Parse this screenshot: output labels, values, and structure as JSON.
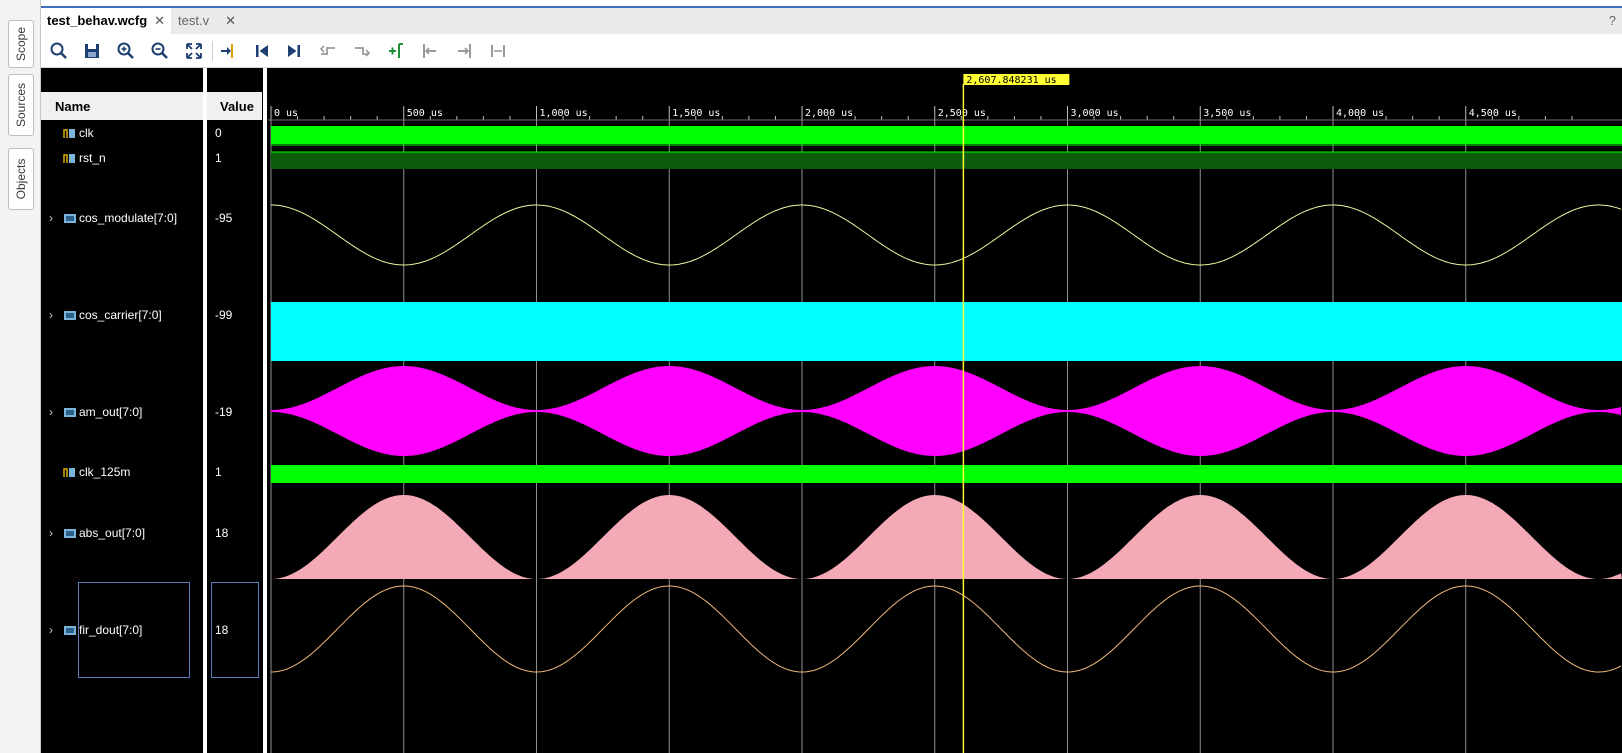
{
  "side_tabs": [
    "Scope",
    "Sources",
    "Objects"
  ],
  "tabs": [
    {
      "label": "test_behav.wcfg",
      "active": true
    },
    {
      "label": "test.v",
      "active": false
    }
  ],
  "help": "?",
  "toolbar_icons": [
    "zoom-search-icon",
    "save-icon",
    "zoom-in-icon",
    "zoom-out-icon",
    "zoom-fit-icon",
    "goto-cursor-icon",
    "go-to-start-icon",
    "go-to-end-icon",
    "previous-transition-icon",
    "next-transition-icon",
    "add-marker-icon",
    "previous-marker-icon",
    "next-marker-icon",
    "swap-cursors-icon"
  ],
  "columns": {
    "name": "Name",
    "value": "Value"
  },
  "cursor": {
    "time_label": "2,607.848231 us",
    "time_us": 2607.848231
  },
  "timeline": {
    "unit": "us",
    "ticks": [
      "0 us",
      "500 us",
      "1,000 us",
      "1,500 us",
      "2,000 us",
      "2,500 us",
      "3,000 us",
      "3,500 us",
      "4,000 us",
      "4,500 us"
    ]
  },
  "signals": [
    {
      "name": "clk",
      "value": "0",
      "kind": "bit",
      "expandable": false
    },
    {
      "name": "rst_n",
      "value": "1",
      "kind": "bit",
      "expandable": false
    },
    {
      "name": "cos_modulate[7:0]",
      "value": "-95",
      "kind": "bus",
      "expandable": true
    },
    {
      "name": "cos_carrier[7:0]",
      "value": "-99",
      "kind": "bus",
      "expandable": true
    },
    {
      "name": "am_out[7:0]",
      "value": "-19",
      "kind": "bus",
      "expandable": true
    },
    {
      "name": "clk_125m",
      "value": "1",
      "kind": "bit",
      "expandable": false
    },
    {
      "name": "abs_out[7:0]",
      "value": "18",
      "kind": "bus",
      "expandable": true
    },
    {
      "name": "fir_dout[7:0]",
      "value": "18",
      "kind": "bus",
      "expandable": true
    }
  ],
  "colors": {
    "clock": "#00ff00",
    "reset_high": "#0d5c0d",
    "cos_modulate": "#f3f3a0",
    "cos_carrier": "#00ffff",
    "am_out": "#ff00ff",
    "abs_out": "#f4a9b6",
    "fir_dout": "#f0b97a",
    "cursor": "#ffff33",
    "grid": "#bfbfbf"
  }
}
